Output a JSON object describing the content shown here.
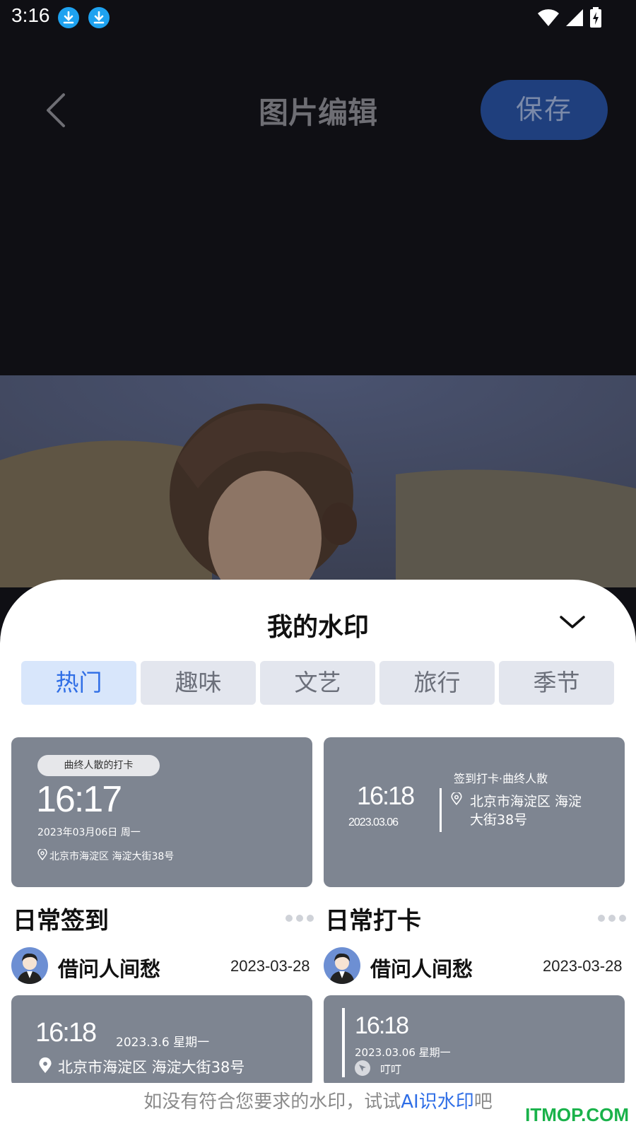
{
  "status_bar": {
    "time": "3:16",
    "icons": [
      "download-icon",
      "download-icon",
      "wifi-icon",
      "signal-icon",
      "battery-charging-icon"
    ]
  },
  "header": {
    "title": "图片编辑",
    "save_label": "保存",
    "back_icon": "chevron-left-icon"
  },
  "sheet": {
    "title": "我的水印",
    "collapse_icon": "chevron-down-icon",
    "tabs": [
      {
        "label": "热门",
        "active": true
      },
      {
        "label": "趣味",
        "active": false
      },
      {
        "label": "文艺",
        "active": false
      },
      {
        "label": "旅行",
        "active": false
      },
      {
        "label": "季节",
        "active": false
      }
    ],
    "cards": [
      {
        "title": "日常签到",
        "user": "借问人间愁",
        "date": "2023-03-28",
        "preview": {
          "tag": "曲终人散的打卡",
          "time": "16:17",
          "date": "2023年03月06日 周一",
          "location": "北京市海淀区 海淀大街38号"
        }
      },
      {
        "title": "日常打卡",
        "user": "借问人间愁",
        "date": "2023-03-28",
        "preview": {
          "time": "16:18",
          "date": "2023.03.06",
          "tag": "签到打卡·曲终人散",
          "location_line1": "北京市海淀区 海淀",
          "location_line2": "大街38号"
        }
      },
      {
        "preview": {
          "time": "16:18",
          "date": "2023.3.6 星期一",
          "location": "北京市海淀区 海淀大街38号"
        }
      },
      {
        "preview": {
          "time": "16:18",
          "date": "2023.03.06 星期一",
          "place": "叮叮"
        }
      }
    ]
  },
  "hint": {
    "prefix": "如没有符合您要求的水印，试试",
    "link": "AI识水印",
    "suffix": "吧"
  },
  "watermark": "ITMOP.COM",
  "colors": {
    "accent": "#2f6ee6",
    "save_bg": "#1f3f7d",
    "card_bg": "#7e8591",
    "tab_bg": "#e3e6ee",
    "tab_active_bg": "#d8e6fb"
  }
}
